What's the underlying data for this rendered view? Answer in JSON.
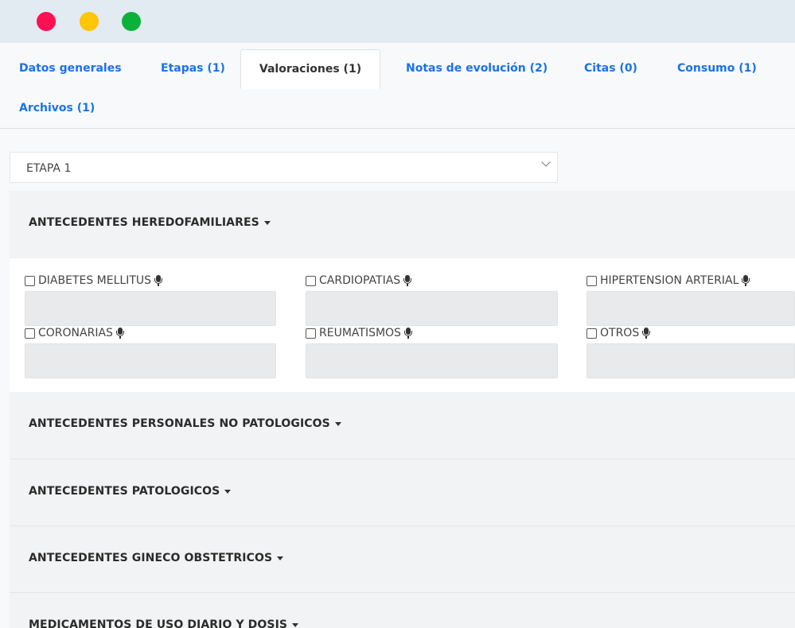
{
  "window": {
    "controls": [
      "close",
      "minimize",
      "maximize"
    ],
    "colors": {
      "close": "#ff1052",
      "minimize": "#ffc507",
      "maximize": "#0cb13a"
    }
  },
  "tabs": [
    {
      "label": "Datos generales"
    },
    {
      "label": "Etapas (1)"
    },
    {
      "label": "Valoraciones (1)",
      "active": true
    },
    {
      "label": "Notas de evolución (2)"
    },
    {
      "label": "Citas (0)"
    },
    {
      "label": "Consumo (1)"
    },
    {
      "label": "Archivos (1)"
    }
  ],
  "stage_select": {
    "value": "ETAPA 1"
  },
  "sections": [
    {
      "title": "ANTECEDENTES HEREDOFAMILIARES",
      "expanded": true
    },
    {
      "title": "ANTECEDENTES PERSONALES NO PATOLOGICOS"
    },
    {
      "title": "ANTECEDENTES PATOLOGICOS"
    },
    {
      "title": "ANTECEDENTES GINECO OBSTETRICOS"
    },
    {
      "title": "MEDICAMENTOS DE USO DIARIO Y DOSIS"
    }
  ],
  "heredofamiliares_fields": [
    {
      "label": "DIABETES MELLITUS",
      "checked": false,
      "value": ""
    },
    {
      "label": "CARDIOPATIAS",
      "checked": false,
      "value": ""
    },
    {
      "label": "HIPERTENSION ARTERIAL",
      "checked": false,
      "value": ""
    },
    {
      "label": "CORONARIAS",
      "checked": false,
      "value": ""
    },
    {
      "label": "REUMATISMOS",
      "checked": false,
      "value": ""
    },
    {
      "label": "OTROS",
      "checked": false,
      "value": ""
    }
  ],
  "accent_color": "#1a73e8"
}
